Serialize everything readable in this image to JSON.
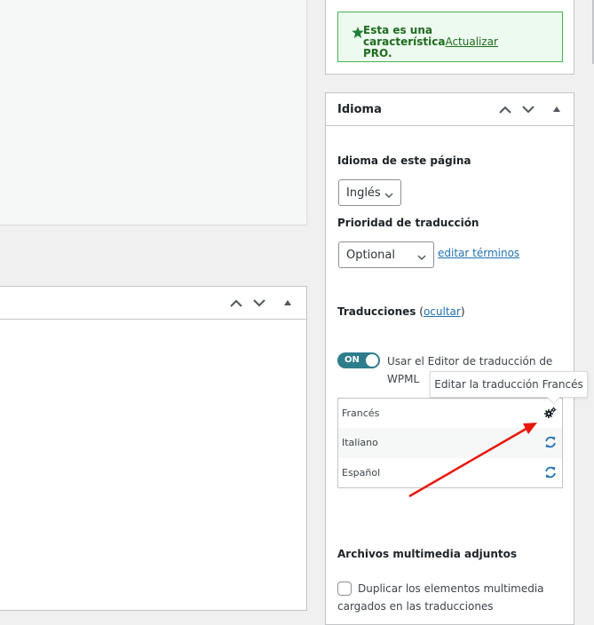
{
  "pro_notice": {
    "text": "Esta es una característica PRO.",
    "text_part1": "Esta es una característica",
    "text_part2": "PRO.",
    "link": "Actualizar",
    "icon": "star-icon",
    "color": "#1e6b1e",
    "bg": "#edfaef",
    "border": "#46b450"
  },
  "language_box": {
    "title": "Idioma",
    "page_language_label": "Idioma de este página",
    "page_language_value": "Inglés",
    "priority_label": "Prioridad de traducción",
    "priority_value": "Optional",
    "edit_terms_link": "editar términos",
    "translations_label": "Traducciones",
    "translations_hide_open": "(",
    "translations_hide_link": "ocultar",
    "translations_hide_close": ")",
    "toggle": {
      "state": "ON",
      "label": "Usar el Editor de traducción de WPML"
    },
    "translations": [
      {
        "language": "Francés",
        "icon": "gears-icon",
        "action": "edit"
      },
      {
        "language": "Italiano",
        "icon": "sync-icon",
        "action": "sync"
      },
      {
        "language": "Español",
        "icon": "sync-icon",
        "action": "sync"
      }
    ],
    "tooltip": "Editar la traducción Francés",
    "media_label": "Archivos multimedia adjuntos",
    "media_checkbox_label": "Duplicar los elementos multimedia cargados en las traducciones",
    "media_checkbox_checked": false
  },
  "colors": {
    "link": "#2271b1",
    "toggle": "#2e7d8c",
    "annotation_arrow": "#e8160c"
  }
}
